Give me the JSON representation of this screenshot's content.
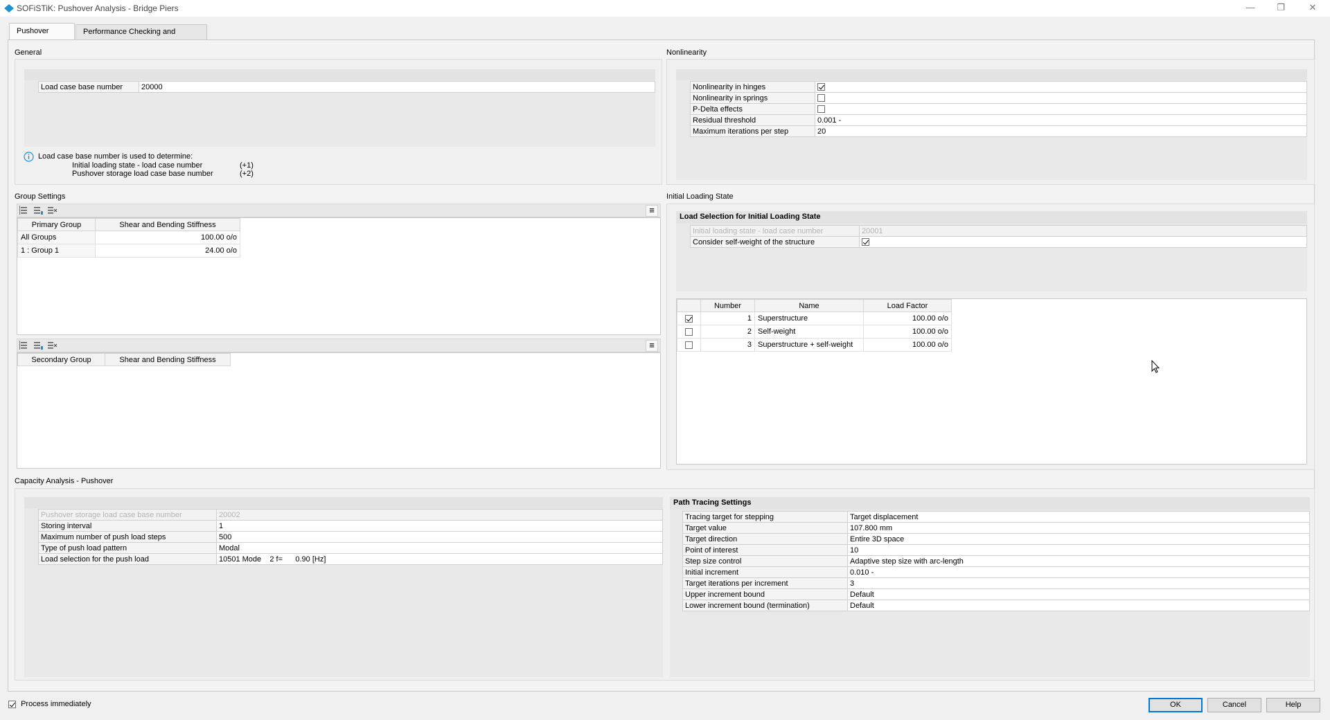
{
  "window": {
    "title": "SOFiSTiK: Pushover Analysis - Bridge Piers",
    "minimize": "—",
    "restore": "❐",
    "close": "✕"
  },
  "tabs": [
    {
      "label": "Pushover Input",
      "active": true
    },
    {
      "label": "Performance Checking and Output",
      "active": false
    }
  ],
  "general": {
    "title": "General",
    "load_case_base_label": "Load case base number",
    "load_case_base_value": "20000",
    "info_line1": "Load case base number is used to determine:",
    "info_line2": "Initial loading state - load case number",
    "info_line2_val": "(+1)",
    "info_line3": "Pushover storage load case base number",
    "info_line3_val": "(+2)"
  },
  "nonlinearity": {
    "title": "Nonlinearity",
    "hinges_label": "Nonlinearity in hinges",
    "hinges_checked": true,
    "springs_label": "Nonlinearity in springs",
    "springs_checked": false,
    "pdelta_label": "P-Delta effects",
    "pdelta_checked": false,
    "residual_label": "Residual threshold",
    "residual_value": "0.001 -",
    "maxiter_label": "Maximum iterations per step",
    "maxiter_value": "20"
  },
  "group_settings": {
    "title": "Group Settings",
    "primary": {
      "headers": [
        "Primary Group",
        "Shear and Bending Stiffness"
      ],
      "rows": [
        {
          "group": "All Groups",
          "value": "100.00 o/o"
        },
        {
          "group": "1 : Group 1",
          "value": "24.00 o/o"
        }
      ]
    },
    "secondary": {
      "headers": [
        "Secondary Group",
        "Shear and Bending Stiffness"
      ]
    },
    "menu_icon": "≡"
  },
  "initial_loading": {
    "title": "Initial Loading State",
    "heading": "Load Selection for Initial Loading State",
    "lc_label": "Initial loading state - load case number",
    "lc_value": "20001",
    "selfweight_label": "Consider self-weight of the structure",
    "selfweight_checked": true,
    "table_headers": [
      "Number",
      "Name",
      "Load Factor"
    ],
    "rows": [
      {
        "checked": true,
        "number": "1",
        "name": "Superstructure",
        "factor": "100.00 o/o"
      },
      {
        "checked": false,
        "number": "2",
        "name": "Self-weight",
        "factor": "100.00 o/o"
      },
      {
        "checked": false,
        "number": "3",
        "name": "Superstructure + self-weight",
        "factor": "100.00 o/o"
      }
    ]
  },
  "capacity": {
    "title": "Capacity Analysis - Pushover",
    "rows": [
      {
        "label": "Pushover storage load case base number",
        "value": "20002",
        "disabled": true
      },
      {
        "label": "Storing interval",
        "value": "1"
      },
      {
        "label": "Maximum number of push load steps",
        "value": "500"
      },
      {
        "label": "Type of push load pattern",
        "value": "Modal"
      },
      {
        "label": "Load selection for the push load",
        "value": "10501 Mode    2 f=      0.90 [Hz]"
      }
    ]
  },
  "path_tracing": {
    "heading": "Path Tracing Settings",
    "rows": [
      {
        "label": "Tracing target for stepping",
        "value": "Target displacement"
      },
      {
        "label": "Target value",
        "value": "107.800 mm"
      },
      {
        "label": "Target direction",
        "value": "Entire 3D space"
      },
      {
        "label": "Point of interest",
        "value": "10"
      },
      {
        "label": "Step size control",
        "value": "Adaptive step size with arc-length"
      },
      {
        "label": "Initial increment",
        "value": "0.010 -"
      },
      {
        "label": "Target iterations per increment",
        "value": "3"
      },
      {
        "label": "Upper increment bound",
        "value": "Default"
      },
      {
        "label": "Lower increment bound (termination)",
        "value": "Default"
      }
    ]
  },
  "footer": {
    "process_label": "Process immediately",
    "process_checked": true,
    "ok": "OK",
    "cancel": "Cancel",
    "help": "Help"
  },
  "colors": {
    "accent": "#0078d7",
    "icon_blue": "#1e90d6"
  }
}
